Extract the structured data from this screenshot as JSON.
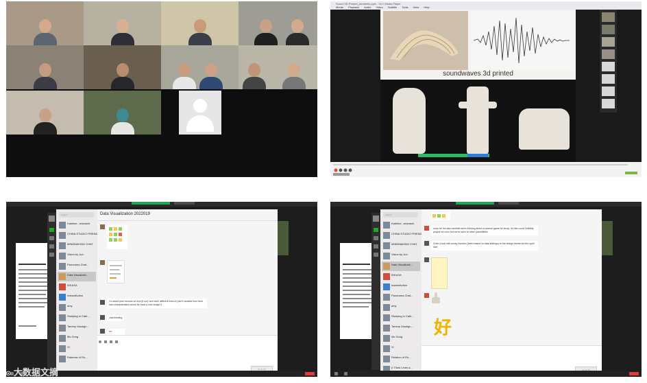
{
  "screen_share": {
    "window_title": "Sound 3D Printed_Aesthetic.pptx - VLC Media Player",
    "menu": [
      "Media",
      "Playback",
      "Audio",
      "Video",
      "Subtitle",
      "Tools",
      "View",
      "Help"
    ],
    "slide_title": "soundwaves 3d printed"
  },
  "chat_panel_left": {
    "chat_title": "Data Visualization 2022019",
    "search_placeholder": "Search",
    "conversations": [
      {
        "name": "Kateline...research",
        "msg": ""
      },
      {
        "name": "CHINA STUDIO FRIENDS",
        "msg": ""
      },
      {
        "name": "MINDMAKING CHAT",
        "msg": ""
      },
      {
        "name": "Vision by Jun",
        "msg": ""
      },
      {
        "name": "Panorama Chat...",
        "msg": ""
      },
      {
        "name": "Data Visualizati...",
        "msg": ""
      },
      {
        "name": "IDEASA",
        "msg": ""
      },
      {
        "name": "InstantAction",
        "msg": ""
      },
      {
        "name": "amy",
        "msg": ""
      },
      {
        "name": "Studying in Cafe...",
        "msg": ""
      },
      {
        "name": "Tammy Xiaotign...",
        "msg": ""
      },
      {
        "name": "Ms Gong",
        "msg": ""
      },
      {
        "name": "Xi",
        "msg": ""
      },
      {
        "name": "Rainbow of Ru...",
        "msg": ""
      }
    ],
    "message_long": "I'm about peer records w/ And (it our) one have different lines of (don't variable from their own characteristics would be have a nice image?)",
    "message_short": "Just thinking",
    "send_label": "Send (S)"
  },
  "chat_panel_right": {
    "search_placeholder": "Search",
    "conversations": [
      {
        "name": "Kateline...research"
      },
      {
        "name": "CHINA STUDIO FRIENDS"
      },
      {
        "name": "MINDMAKING CHAT"
      },
      {
        "name": "Vision by Jun"
      },
      {
        "name": "Data Visualizati..."
      },
      {
        "name": "IDEASA"
      },
      {
        "name": "InstantAction"
      },
      {
        "name": "Panorama Chat..."
      },
      {
        "name": "amy"
      },
      {
        "name": "Studying in Cafe..."
      },
      {
        "name": "Tammy Xiaotign..."
      },
      {
        "name": "Ms Gong"
      },
      {
        "name": "Xi"
      },
      {
        "name": "Relation of Ru..."
      },
      {
        "name": "(I Think Linim a..."
      }
    ],
    "message_a": "sorry for the late candidel we're thinking about a science game for study. It's like count Visibility project for color but we're open to other possibilities",
    "message_b": "Chen (Lind) will survey function (been based on data feelings) to the design theme but the spell side",
    "sticker_text": "好",
    "send_label": "Send (S)"
  },
  "watermark": "大数据文摘"
}
